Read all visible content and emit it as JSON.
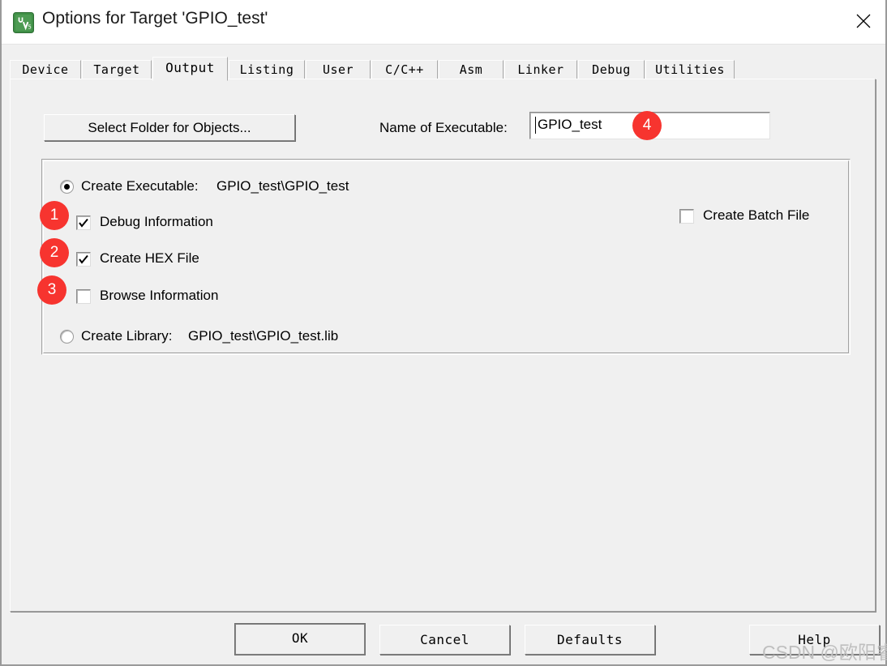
{
  "window": {
    "title": "Options for Target 'GPIO_test'",
    "icon": "keil-uvision-logo-icon",
    "close_icon": "close-icon"
  },
  "tabs": [
    {
      "label": "Device",
      "active": false
    },
    {
      "label": "Target",
      "active": false
    },
    {
      "label": "Output",
      "active": true
    },
    {
      "label": "Listing",
      "active": false
    },
    {
      "label": "User",
      "active": false
    },
    {
      "label": "C/C++",
      "active": false
    },
    {
      "label": "Asm",
      "active": false
    },
    {
      "label": "Linker",
      "active": false
    },
    {
      "label": "Debug",
      "active": false
    },
    {
      "label": "Utilities",
      "active": false
    }
  ],
  "output_tab": {
    "select_folder_button": "Select Folder for Objects...",
    "executable_label": "Name of Executable:",
    "executable_value": "GPIO_test",
    "executable_placeholder": "",
    "create_executable": {
      "label": "Create Executable:",
      "path": "GPIO_test\\GPIO_test",
      "selected": true
    },
    "debug_information": {
      "label": "Debug Information",
      "checked": true
    },
    "create_hex_file": {
      "label": "Create HEX File",
      "checked": true
    },
    "browse_information": {
      "label": "Browse Information",
      "checked": false
    },
    "create_batch_file": {
      "label": "Create Batch File",
      "checked": false
    },
    "create_library": {
      "label": "Create Library:",
      "path": "GPIO_test\\GPIO_test.lib",
      "selected": false
    }
  },
  "annotations": [
    {
      "number": "1",
      "target": "debug-information-checkbox"
    },
    {
      "number": "2",
      "target": "create-hex-file-checkbox"
    },
    {
      "number": "3",
      "target": "browse-information-checkbox"
    },
    {
      "number": "4",
      "target": "name-of-executable-input"
    }
  ],
  "annotation_color": "#f7342f",
  "footer": {
    "ok": "OK",
    "cancel": "Cancel",
    "defaults": "Defaults",
    "help": "Help"
  },
  "watermark": "CSDN @欧阳睿"
}
